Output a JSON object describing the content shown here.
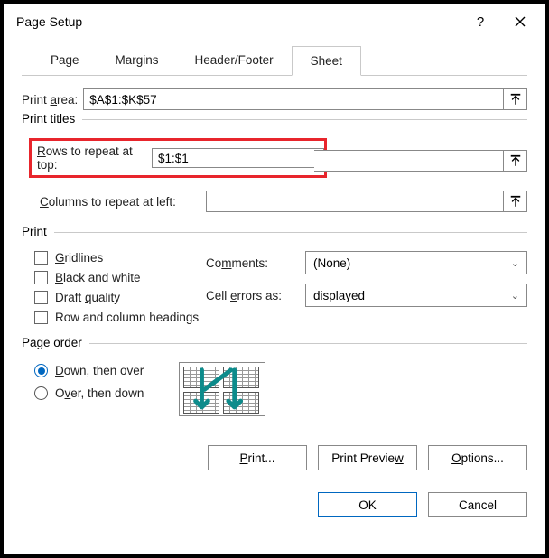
{
  "title": "Page Setup",
  "tabs": {
    "page": "Page",
    "margins": "Margins",
    "header_footer": "Header/Footer",
    "sheet": "Sheet"
  },
  "print_area": {
    "label": "Print area:",
    "value": "$A$1:$K$57"
  },
  "print_titles": {
    "legend": "Print titles",
    "rows_label": "Rows to repeat at top:",
    "rows_value": "$1:$1",
    "cols_label": "Columns to repeat at left:",
    "cols_value": ""
  },
  "print": {
    "legend": "Print",
    "gridlines": "Gridlines",
    "bw": "Black and white",
    "draft": "Draft quality",
    "rowcol": "Row and column headings",
    "comments_label": "Comments:",
    "comments_value": "(None)",
    "errors_label": "Cell errors as:",
    "errors_value": "displayed"
  },
  "page_order": {
    "legend": "Page order",
    "down": "Down, then over",
    "over": "Over, then down"
  },
  "buttons": {
    "print": "Print...",
    "preview": "Print Preview",
    "options": "Options...",
    "ok": "OK",
    "cancel": "Cancel"
  }
}
